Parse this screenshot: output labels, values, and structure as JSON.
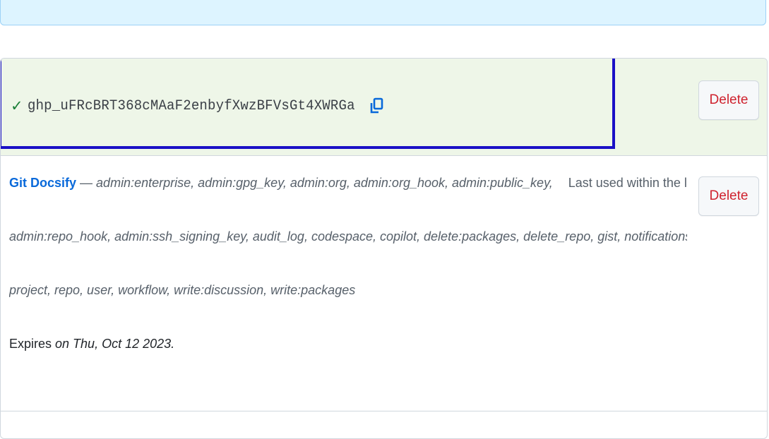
{
  "new_token": {
    "check_glyph": "✓",
    "value": "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",
    "copy_icon": "copy-icon",
    "delete_label": "Delete"
  },
  "token": {
    "name": "Git Docsify",
    "dash": " — ",
    "scopes_line1": "admin:enterprise, admin:gpg_key, admin:org, admin:org_hook, admin:public_key,",
    "last_used": "Last used within the last week",
    "scopes_line2": "admin:repo_hook, admin:ssh_signing_key, audit_log, codespace, copilot, delete:packages, delete_repo, gist, notifications,",
    "scopes_line3": "project, repo, user, workflow, write:discussion, write:packages",
    "expires_label": "Expires",
    "expires_date": " on Thu, Oct 12 2023.",
    "delete_label": "Delete"
  },
  "colors": {
    "banner_bg": "#ddf4ff",
    "new_token_bg": "#eef6e8",
    "highlight_border": "#1a10c6",
    "link": "#0969da",
    "danger": "#cf222e",
    "success": "#1a7f37"
  }
}
